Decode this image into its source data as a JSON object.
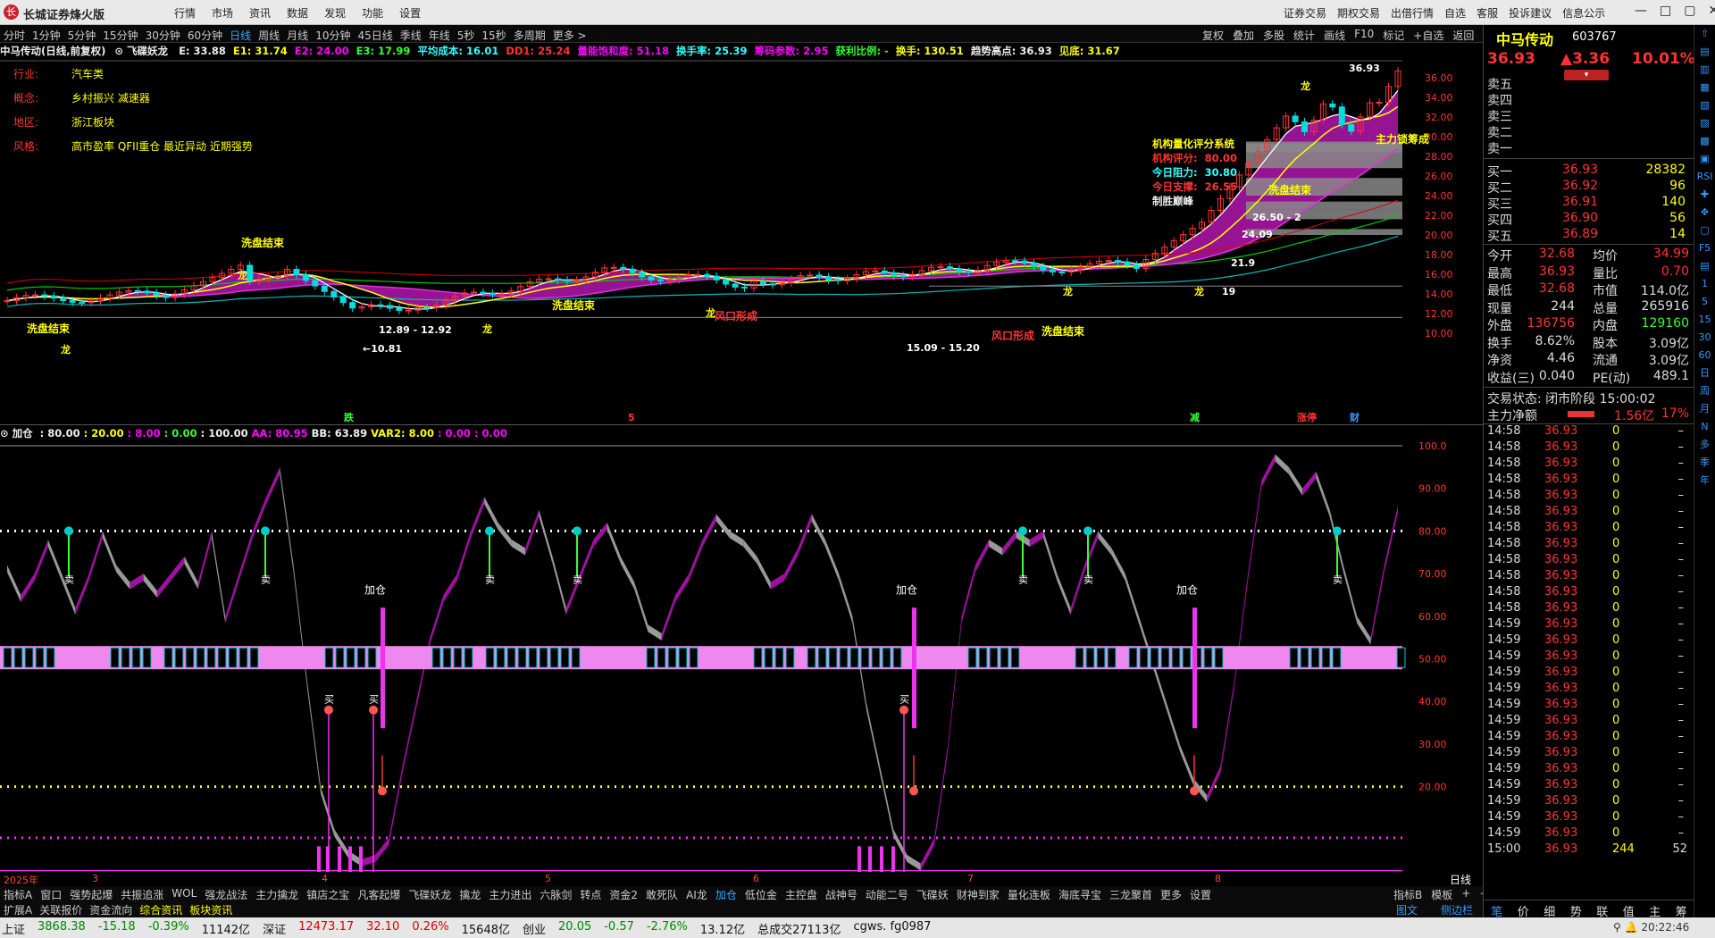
{
  "app": {
    "title": "长城证券烽火版",
    "logo": "长"
  },
  "menu_left": [
    "行情",
    "市场",
    "资讯",
    "数据",
    "发现",
    "功能",
    "设置"
  ],
  "menu_right": [
    "证券交易",
    "期权交易",
    "出借行情",
    "自选",
    "客服",
    "投诉建议",
    "信息公示"
  ],
  "window_buttons": [
    "—",
    "□",
    "▢",
    "✕"
  ],
  "periods": [
    "分时",
    "1分钟",
    "5分钟",
    "15分钟",
    "30分钟",
    "60分钟",
    "日线",
    "周线",
    "月线",
    "10分钟",
    "45日线",
    "季线",
    "年线",
    "5秒",
    "15秒",
    "多周期",
    "更多 >"
  ],
  "active_period": "日线",
  "period_right": [
    "复权",
    "叠加",
    "多股",
    "统计",
    "画线",
    "F10",
    "标记",
    "+自选",
    "返回"
  ],
  "infobar": {
    "name": "中马传动(日线,前复权)",
    "indicator": "飞碟妖龙",
    "items": [
      {
        "t": "E: 33.88",
        "c": "w"
      },
      {
        "t": "E1: 31.74",
        "c": "y"
      },
      {
        "t": "E2: 24.00",
        "c": "m"
      },
      {
        "t": "E3: 17.99",
        "c": "g"
      },
      {
        "t": "平均成本: 16.01",
        "c": "c"
      },
      {
        "t": "DD1: 25.24",
        "c": "r"
      },
      {
        "t": "量能饱和度: 51.18",
        "c": "m"
      },
      {
        "t": "换手率: 25.39",
        "c": "c"
      },
      {
        "t": "筹码参数: 2.95",
        "c": "m"
      },
      {
        "t": "获利比例: -",
        "c": "g"
      },
      {
        "t": "换手: 130.51",
        "c": "y"
      },
      {
        "t": "趋势高点: 36.93",
        "c": "w"
      },
      {
        "t": "见底: 31.67",
        "c": "y"
      }
    ]
  },
  "stock_info": [
    {
      "label": "行业:",
      "value": "汽车类"
    },
    {
      "label": "概念:",
      "value": "乡村振兴 减速器"
    },
    {
      "label": "地区:",
      "value": "浙江板块"
    },
    {
      "label": "风格:",
      "value": "高市盈率 QFII重仓 最近异动 近期强势"
    }
  ],
  "score_system": {
    "title": "机构量化评分系统",
    "lines": [
      {
        "label": "机构评分:",
        "value": "80.00",
        "c": "r"
      },
      {
        "label": "今日阻力:",
        "value": "30.80",
        "c": "c"
      },
      {
        "label": "今日支撑:",
        "value": "26.55",
        "c": "r"
      }
    ],
    "footer": "制胜巅峰"
  },
  "price_axis": [
    "36.00",
    "34.00",
    "32.00",
    "30.00",
    "28.00",
    "26.00",
    "24.00",
    "22.00",
    "20.00",
    "18.00",
    "16.00",
    "14.00",
    "12.00",
    "10.00"
  ],
  "price_annotations": {
    "high": "36.93",
    "low": "10.81",
    "range1": "12.89 - 12.92",
    "range2": "15.09 - 15.20",
    "range3": "26.50 - 2",
    "lvl1": "24.09",
    "lvl2": "21.9",
    "lvl3": "19"
  },
  "chart_labels": [
    "洗盘结束",
    "风口形成",
    "主力锁筹成",
    "龙",
    "跌",
    "5",
    "减",
    "涨停",
    "财",
    "加仓",
    "买",
    "卖"
  ],
  "indicator_bar": {
    "name": "加仓",
    "values": [
      {
        "t": ": 80.00",
        "c": "w"
      },
      {
        "t": ": 20.00",
        "c": "y"
      },
      {
        "t": ": 8.00",
        "c": "m"
      },
      {
        "t": ": 0.00",
        "c": "g"
      },
      {
        "t": ": 100.00",
        "c": "w"
      },
      {
        "t": "AA: 80.95",
        "c": "m"
      },
      {
        "t": "BB: 63.89",
        "c": "w"
      },
      {
        "t": "VAR2: 8.00",
        "c": "y"
      },
      {
        "t": ": 0.00",
        "c": "m"
      },
      {
        "t": ": 0.00",
        "c": "m"
      }
    ]
  },
  "lower_axis": [
    "100.0",
    "90.00",
    "80.00",
    "70.00",
    "60.00",
    "50.00",
    "40.00",
    "30.00",
    "20.00"
  ],
  "x_axis": [
    "2025年",
    "3",
    "4",
    "5",
    "6",
    "7",
    "8"
  ],
  "x_axis_right": "日线",
  "bottom_tabs": [
    "指标A",
    "窗口",
    "强势起爆",
    "共振追涨",
    "WOL",
    "强龙战法",
    "主力擒龙",
    "镇店之宝",
    "凡客起爆",
    "飞碟妖龙",
    "擒龙",
    "主力进出",
    "六脉剑",
    "转点",
    "资金2",
    "敢死队",
    "AI龙",
    "加仓",
    "低位金",
    "主控盘",
    "战神号",
    "动能二号",
    "飞碟妖",
    "财神到家",
    "量化连板",
    "海底寻宝",
    "三龙聚首",
    "更多",
    "设置"
  ],
  "bottom_tabs_active": "加仓",
  "bottom_tabs_right": [
    "指标B",
    "模板",
    "+",
    "−"
  ],
  "bottom_tabs2": [
    "扩展A",
    "关联报价",
    "资金流向",
    "综合资讯",
    "板块资讯"
  ],
  "bottom_tabs2_right": [
    "图文F10",
    "侧边栏 《"
  ],
  "right": {
    "name": "中马传动",
    "code": "603767",
    "price": "36.93",
    "change": "▲3.36",
    "pct": "10.01%",
    "sell": [
      {
        "l": "卖五",
        "p": "",
        "v": ""
      },
      {
        "l": "卖四",
        "p": "",
        "v": ""
      },
      {
        "l": "卖三",
        "p": "",
        "v": ""
      },
      {
        "l": "卖二",
        "p": "",
        "v": ""
      },
      {
        "l": "卖一",
        "p": "",
        "v": ""
      }
    ],
    "buy": [
      {
        "l": "买一",
        "p": "36.93",
        "v": "28382"
      },
      {
        "l": "买二",
        "p": "36.92",
        "v": "96"
      },
      {
        "l": "买三",
        "p": "36.91",
        "v": "140"
      },
      {
        "l": "买四",
        "p": "36.90",
        "v": "56"
      },
      {
        "l": "买五",
        "p": "36.89",
        "v": "14"
      }
    ],
    "stats": [
      {
        "a": "今开",
        "b": "32.68",
        "c": "均价",
        "d": "34.99",
        "bc": "r",
        "dc": "r"
      },
      {
        "a": "最高",
        "b": "36.93",
        "c": "量比",
        "d": "0.70",
        "bc": "r",
        "dc": "r"
      },
      {
        "a": "最低",
        "b": "32.68",
        "c": "市值",
        "d": "114.0亿",
        "bc": "r",
        "dc": "w"
      },
      {
        "a": "现量",
        "b": "244",
        "c": "总量",
        "d": "265916",
        "bc": "w",
        "dc": "w"
      },
      {
        "a": "外盘",
        "b": "136756",
        "c": "内盘",
        "d": "129160",
        "bc": "r",
        "dc": "g"
      },
      {
        "a": "换手",
        "b": "8.62%",
        "c": "股本",
        "d": "3.09亿",
        "bc": "w",
        "dc": "w"
      },
      {
        "a": "净资",
        "b": "4.46",
        "c": "流通",
        "d": "3.09亿",
        "bc": "w",
        "dc": "w"
      },
      {
        "a": "收益(三)",
        "b": "0.040",
        "c": "PE(动)",
        "d": "489.1",
        "bc": "w",
        "dc": "w"
      }
    ],
    "trade_state": "交易状态: 闭市阶段 15:00:02",
    "main_net": {
      "label": "主力净额",
      "value": "1.56亿",
      "pct": "17%"
    },
    "ticks": [
      {
        "t": "14:58",
        "p": "36.93",
        "v": "0"
      },
      {
        "t": "14:58",
        "p": "36.93",
        "v": "0"
      },
      {
        "t": "14:58",
        "p": "36.93",
        "v": "0"
      },
      {
        "t": "14:58",
        "p": "36.93",
        "v": "0"
      },
      {
        "t": "14:58",
        "p": "36.93",
        "v": "0"
      },
      {
        "t": "14:58",
        "p": "36.93",
        "v": "0"
      },
      {
        "t": "14:58",
        "p": "36.93",
        "v": "0"
      },
      {
        "t": "14:58",
        "p": "36.93",
        "v": "0"
      },
      {
        "t": "14:58",
        "p": "36.93",
        "v": "0"
      },
      {
        "t": "14:58",
        "p": "36.93",
        "v": "0"
      },
      {
        "t": "14:58",
        "p": "36.93",
        "v": "0"
      },
      {
        "t": "14:58",
        "p": "36.93",
        "v": "0"
      },
      {
        "t": "14:59",
        "p": "36.93",
        "v": "0"
      },
      {
        "t": "14:59",
        "p": "36.93",
        "v": "0"
      },
      {
        "t": "14:59",
        "p": "36.93",
        "v": "0"
      },
      {
        "t": "14:59",
        "p": "36.93",
        "v": "0"
      },
      {
        "t": "14:59",
        "p": "36.93",
        "v": "0"
      },
      {
        "t": "14:59",
        "p": "36.93",
        "v": "0"
      },
      {
        "t": "14:59",
        "p": "36.93",
        "v": "0"
      },
      {
        "t": "14:59",
        "p": "36.93",
        "v": "0"
      },
      {
        "t": "14:59",
        "p": "36.93",
        "v": "0"
      },
      {
        "t": "14:59",
        "p": "36.93",
        "v": "0"
      },
      {
        "t": "14:59",
        "p": "36.93",
        "v": "0"
      },
      {
        "t": "14:59",
        "p": "36.93",
        "v": "0"
      },
      {
        "t": "14:59",
        "p": "36.93",
        "v": "0"
      },
      {
        "t": "14:59",
        "p": "36.93",
        "v": "0"
      },
      {
        "t": "15:00",
        "p": "36.93",
        "v": "244",
        "last": "52"
      }
    ],
    "bottom_tabs": [
      "笔",
      "价",
      "细",
      "势",
      "联",
      "值",
      "主",
      "筹"
    ]
  },
  "sidebar": [
    "⇧",
    "▤",
    "▥",
    "▦",
    "▧",
    "▨",
    "▩",
    "▣",
    "RSI",
    "✚",
    "✥",
    "▢",
    "F5",
    "▤",
    "1",
    "5",
    "15",
    "30",
    "60",
    "日",
    "周",
    "月",
    "N",
    "多",
    "季",
    "年"
  ],
  "status": {
    "items": [
      {
        "t": "上证",
        "c": "k"
      },
      {
        "t": "3868.38",
        "c": "g"
      },
      {
        "t": "-15.18",
        "c": "g"
      },
      {
        "t": "-0.39%",
        "c": "g"
      },
      {
        "t": "11142亿",
        "c": "k"
      },
      {
        "t": "深证",
        "c": "k"
      },
      {
        "t": "12473.17",
        "c": "r"
      },
      {
        "t": "32.10",
        "c": "r"
      },
      {
        "t": "0.26%",
        "c": "r"
      },
      {
        "t": "15648亿",
        "c": "k"
      },
      {
        "t": "创业",
        "c": "k"
      },
      {
        "t": "20.05",
        "c": "g"
      },
      {
        "t": "-0.57",
        "c": "g"
      },
      {
        "t": "-2.76%",
        "c": "g"
      },
      {
        "t": "13.12亿",
        "c": "k"
      },
      {
        "t": "总成交27113亿",
        "c": "k"
      },
      {
        "t": "cgws. fg0987",
        "c": "k"
      }
    ],
    "time": "20:22:46"
  }
}
